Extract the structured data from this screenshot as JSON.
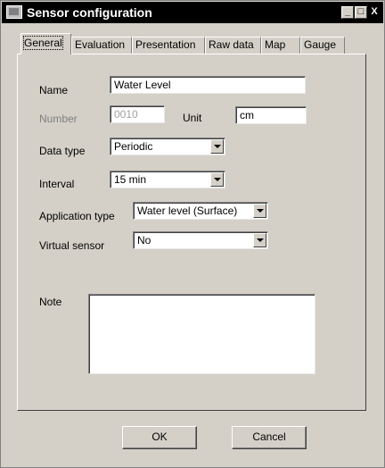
{
  "window": {
    "title": "Sensor configuration",
    "controls": {
      "minimize": "_",
      "maximize": "□",
      "close": "X"
    },
    "icon": "app-icon"
  },
  "tabs": [
    {
      "label": "General",
      "active": true
    },
    {
      "label": "Evaluation",
      "active": false
    },
    {
      "label": "Presentation",
      "active": false
    },
    {
      "label": "Raw data",
      "active": false
    },
    {
      "label": "Map",
      "active": false
    },
    {
      "label": "Gauge",
      "active": false
    }
  ],
  "form": {
    "name": {
      "label": "Name",
      "value": "Water Level"
    },
    "number": {
      "label": "Number",
      "value": "0010"
    },
    "unit": {
      "label": "Unit",
      "value": "cm"
    },
    "data_type": {
      "label": "Data type",
      "value": "Periodic"
    },
    "interval": {
      "label": "Interval",
      "value": "15 min"
    },
    "application_type": {
      "label": "Application type",
      "value": "Water level (Surface)"
    },
    "virtual_sensor": {
      "label": "Virtual sensor",
      "value": "No"
    },
    "note": {
      "label": "Note",
      "value": ""
    }
  },
  "buttons": {
    "ok": "OK",
    "cancel": "Cancel"
  }
}
